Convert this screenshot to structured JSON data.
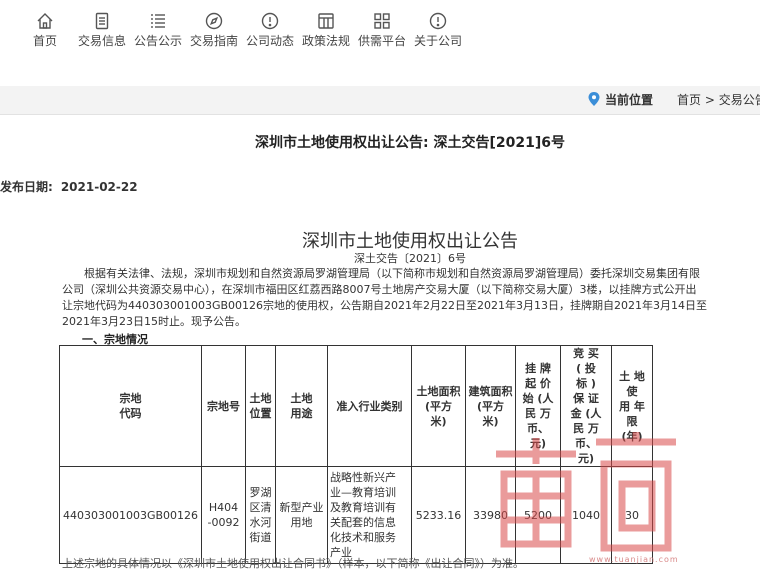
{
  "nav": [
    {
      "label": "首页",
      "icon": "home-icon"
    },
    {
      "label": "交易信息",
      "icon": "document-icon"
    },
    {
      "label": "公告公示",
      "icon": "list-icon"
    },
    {
      "label": "交易指南",
      "icon": "compass-icon"
    },
    {
      "label": "公司动态",
      "icon": "info-icon"
    },
    {
      "label": "政策法规",
      "icon": "building-icon"
    },
    {
      "label": "供需平台",
      "icon": "grid-icon"
    },
    {
      "label": "关于公司",
      "icon": "info-icon"
    }
  ],
  "location": {
    "label": "当前位置",
    "crumbs": [
      "首页",
      ">",
      "交易公告"
    ]
  },
  "page_title": "深圳市土地使用权出让公告: 深土交告[2021]6号",
  "publish": {
    "label": "发布日期:",
    "date": "2021-02-22"
  },
  "doc": {
    "title": "深圳市土地使用权出让公告",
    "subtitle": "深土交告〔2021〕6号",
    "para_lines": [
      "根据有关法律、法规，深圳市规划和自然资源局罗湖管理局（以下简称市规划和自然资源局罗湖管理局）委托深圳交易集团有限",
      "公司（深圳公共资源交易中心），在深圳市福田区红荔西路8007号土地房产交易大厦（以下简称交易大厦）3楼，以挂牌方式公开出",
      "让宗地代码为440303001003GB00126宗地的使用权，公告期自2021年2月22日至2021年3月13日，挂牌期自2021年3月14日至",
      "2021年3月23日15时止。现予公告。"
    ],
    "section": "一、宗地情况"
  },
  "table": {
    "headers": [
      [
        "宗地",
        "代码"
      ],
      [
        "宗地号"
      ],
      [
        "土地",
        "位置"
      ],
      [
        "土地",
        "用途"
      ],
      [
        "准入行业类别"
      ],
      [
        "土地面积",
        "(平方",
        "米)"
      ],
      [
        "建筑面积",
        "(平方",
        "米)"
      ],
      [
        "挂 牌",
        "起 价",
        "始 (人",
        "民 万",
        "币、",
        "元)"
      ],
      [
        "竞 买",
        "( 投",
        "标 )",
        "保 证",
        "金 (人",
        "民 万",
        "币、",
        "元)"
      ],
      [
        "土 地 使",
        "用 年 限",
        "(年)"
      ]
    ],
    "row": [
      [
        "440303001003GB00126"
      ],
      [
        "H404",
        "-0092"
      ],
      [
        "罗湖",
        "区清",
        "水河",
        "街道"
      ],
      [
        "新型产业",
        "用地"
      ],
      [
        "战略性新兴产",
        "业—教育培训",
        "及教育培训有",
        "关配套的信息",
        "化技术和服务",
        "产业"
      ],
      [
        "5233.16"
      ],
      [
        "33980"
      ],
      [
        "5200"
      ],
      [
        "1040"
      ],
      [
        "30"
      ]
    ]
  },
  "footer_text": "上述宗地的具体情况以《深圳市土地使用权出让合同书》（样本，以下简称《出让合同》）为准。",
  "watermark": {
    "text": "www.tuanjian.com"
  },
  "colors": {
    "watermark": "#d94a4a",
    "accent_blue": "#3b8ed8"
  }
}
